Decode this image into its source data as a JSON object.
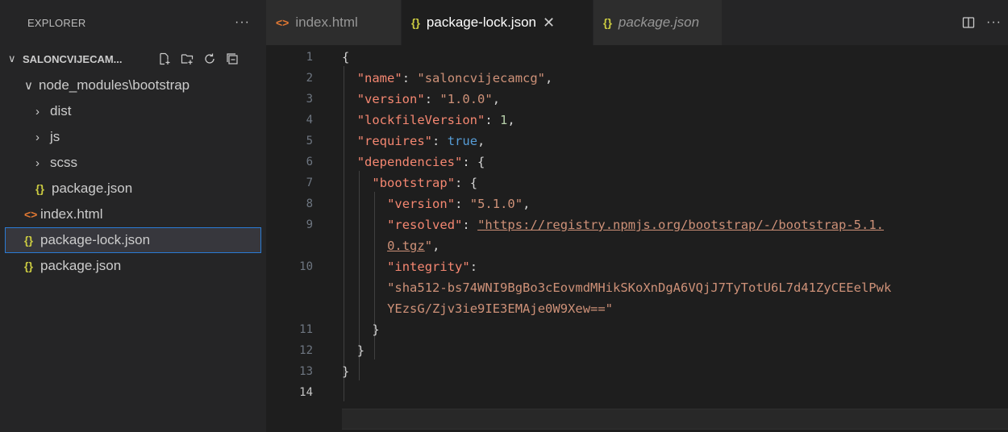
{
  "sidebar": {
    "title": "EXPLORER",
    "more": "···",
    "folder": "SALONCVIJECAM...",
    "tree": [
      {
        "label": "node_modules\\bootstrap",
        "chevron": "∨",
        "icon": "",
        "indent": 1
      },
      {
        "label": "dist",
        "chevron": "›",
        "icon": "",
        "indent": 2
      },
      {
        "label": "js",
        "chevron": "›",
        "icon": "",
        "indent": 2
      },
      {
        "label": "scss",
        "chevron": "›",
        "icon": "",
        "indent": 2
      },
      {
        "label": "package.json",
        "chevron": "",
        "icon": "{}",
        "indent": 2
      },
      {
        "label": "index.html",
        "chevron": "",
        "icon": "<>",
        "indent": 1
      },
      {
        "label": "package-lock.json",
        "chevron": "",
        "icon": "{}",
        "indent": 1,
        "selected": true
      },
      {
        "label": "package.json",
        "chevron": "",
        "icon": "{}",
        "indent": 1
      }
    ]
  },
  "tabs": [
    {
      "label": "index.html",
      "icon": "<>",
      "type": "html",
      "active": false,
      "italic": false
    },
    {
      "label": "package-lock.json",
      "icon": "{}",
      "type": "json",
      "active": true,
      "italic": false,
      "close": "✕"
    },
    {
      "label": "package.json",
      "icon": "{}",
      "type": "json",
      "active": false,
      "italic": true
    }
  ],
  "tab_actions": {
    "split": "split-editor-icon",
    "more": "···"
  },
  "editor": {
    "lines": [
      {
        "num": "1",
        "code": "{"
      },
      {
        "num": "2",
        "code": "  \"name\": \"saloncvijecamcg\","
      },
      {
        "num": "3",
        "code": "  \"version\": \"1.0.0\","
      },
      {
        "num": "4",
        "code": "  \"lockfileVersion\": 1,"
      },
      {
        "num": "5",
        "code": "  \"requires\": true,"
      },
      {
        "num": "6",
        "code": "  \"dependencies\": {"
      },
      {
        "num": "7",
        "code": "    \"bootstrap\": {"
      },
      {
        "num": "8",
        "code": "      \"version\": \"5.1.0\","
      },
      {
        "num": "9",
        "code": "      \"resolved\": \"https://registry.npmjs.org/bootstrap/-/bootstrap-5.1."
      },
      {
        "num": "",
        "code": "      0.tgz\","
      },
      {
        "num": "10",
        "code": "      \"integrity\":"
      },
      {
        "num": "",
        "code": "      \"sha512-bs74WNI9BgBo3cEovmdMHikSKoXnDgA6VQjJ7TyTotU6L7d41ZyCEEelPwk"
      },
      {
        "num": "",
        "code": "      YEzsG/Zjv3ie9IE3EMAje0W9Xew==\""
      },
      {
        "num": "11",
        "code": "    }"
      },
      {
        "num": "12",
        "code": "  }"
      },
      {
        "num": "13",
        "code": "}"
      },
      {
        "num": "14",
        "code": ""
      }
    ],
    "current_line": "14"
  },
  "colors": {
    "sidebar_bg": "#252526",
    "editor_bg": "#1e1e1e",
    "selection_border": "#2a7bd4",
    "json_icon": "#cbcb41",
    "html_icon": "#e37933"
  }
}
